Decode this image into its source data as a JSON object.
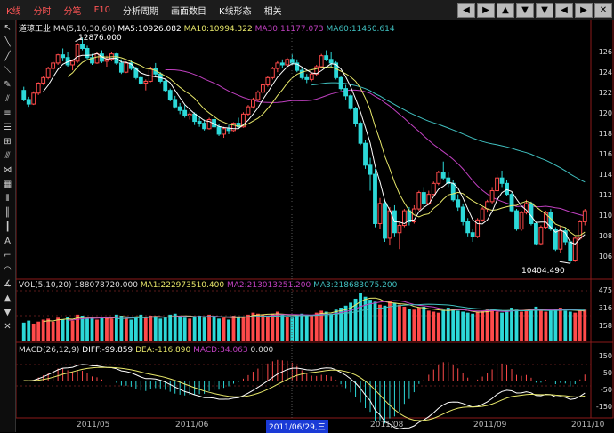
{
  "menu": [
    "K线",
    "分时",
    "分笔",
    "F10",
    "分析周期",
    "画面数目",
    "K线形态",
    "相关"
  ],
  "nav_buttons": [
    "◀",
    "▶",
    "▲",
    "▼",
    "▼",
    "◀",
    "▶",
    "✕"
  ],
  "stock_name": "道琼工业",
  "price_indicator": {
    "name": "MA(5,10,30,60)",
    "ma5": "MA5:10926.082",
    "ma10": "MA10:10994.322",
    "ma30": "MA30:11177.073",
    "ma60": "MA60:11450.614"
  },
  "high_label": "12876.000",
  "low_label": "10404.490",
  "vol_indicator": {
    "name": "VOL(5,10,20)",
    "value": "188078720.000",
    "ma1": "MA1:222973510.400",
    "ma2": "MA2:213013251.200",
    "ma3": "MA3:218683075.200"
  },
  "macd_indicator": {
    "name": "MACD(26,12,9)",
    "diff": "DIFF:-99.859",
    "dea": "DEA:-116.890",
    "macd": "MACD:34.063",
    "zero": "0.000"
  },
  "x_dates": [
    "2011/05",
    "2011/06",
    "2011/08",
    "2011/09",
    "2011/10"
  ],
  "date_cursor": "2011/06/29,三",
  "y_price_ticks": [
    "126",
    "124",
    "122",
    "120",
    "118",
    "116",
    "114",
    "112",
    "110",
    "108",
    "106"
  ],
  "y_vol_ticks": [
    "475",
    "316",
    "158"
  ],
  "y_macd_ticks": [
    "150",
    "50",
    "-50",
    "-150"
  ],
  "colors": {
    "up": "#ff4a4a",
    "down": "#2cd8d8",
    "ma5": "#ffffff",
    "ma10": "#e8e86a",
    "ma30": "#c040c0",
    "ma60": "#40c0c0"
  },
  "chart_data": {
    "type": "candlestick",
    "series_note": "Dow Jones Industrial daily OHLC, approx. May–Oct 2011",
    "ylim": [
      10250,
      12950
    ],
    "candles": [
      [
        12300,
        12340,
        12180,
        12200
      ],
      [
        12200,
        12230,
        12120,
        12150
      ],
      [
        12150,
        12290,
        12140,
        12270
      ],
      [
        12270,
        12390,
        12250,
        12380
      ],
      [
        12380,
        12460,
        12360,
        12440
      ],
      [
        12440,
        12560,
        12420,
        12540
      ],
      [
        12540,
        12620,
        12500,
        12600
      ],
      [
        12600,
        12700,
        12580,
        12690
      ],
      [
        12690,
        12760,
        12620,
        12660
      ],
      [
        12660,
        12720,
        12560,
        12580
      ],
      [
        12580,
        12640,
        12520,
        12620
      ],
      [
        12620,
        12820,
        12600,
        12800
      ],
      [
        12800,
        12876,
        12740,
        12760
      ],
      [
        12760,
        12790,
        12640,
        12660
      ],
      [
        12660,
        12700,
        12580,
        12600
      ],
      [
        12600,
        12720,
        12590,
        12700
      ],
      [
        12700,
        12740,
        12600,
        12620
      ],
      [
        12620,
        12680,
        12560,
        12640
      ],
      [
        12640,
        12720,
        12620,
        12700
      ],
      [
        12700,
        12710,
        12580,
        12600
      ],
      [
        12600,
        12640,
        12480,
        12500
      ],
      [
        12500,
        12620,
        12490,
        12600
      ],
      [
        12600,
        12630,
        12520,
        12540
      ],
      [
        12540,
        12560,
        12420,
        12440
      ],
      [
        12440,
        12460,
        12360,
        12380
      ],
      [
        12380,
        12420,
        12300,
        12400
      ],
      [
        12400,
        12560,
        12390,
        12540
      ],
      [
        12540,
        12600,
        12460,
        12480
      ],
      [
        12480,
        12500,
        12380,
        12400
      ],
      [
        12400,
        12420,
        12280,
        12300
      ],
      [
        12300,
        12320,
        12180,
        12200
      ],
      [
        12200,
        12240,
        12100,
        12120
      ],
      [
        12120,
        12160,
        12040,
        12080
      ],
      [
        12080,
        12140,
        12000,
        12020
      ],
      [
        12020,
        12060,
        11980,
        12040
      ],
      [
        12040,
        12060,
        11920,
        11960
      ],
      [
        11960,
        12000,
        11900,
        11940
      ],
      [
        11940,
        11980,
        11860,
        11880
      ],
      [
        11880,
        12000,
        11870,
        11980
      ],
      [
        11980,
        12020,
        11880,
        11900
      ],
      [
        11900,
        11930,
        11800,
        11820
      ],
      [
        11820,
        11900,
        11780,
        11880
      ],
      [
        11880,
        11920,
        11820,
        11860
      ],
      [
        11860,
        11950,
        11850,
        11940
      ],
      [
        11940,
        12000,
        11880,
        11900
      ],
      [
        11900,
        12060,
        11890,
        12040
      ],
      [
        12040,
        12140,
        12020,
        12120
      ],
      [
        12120,
        12220,
        12100,
        12200
      ],
      [
        12200,
        12300,
        12180,
        12280
      ],
      [
        12280,
        12380,
        12260,
        12360
      ],
      [
        12360,
        12460,
        12340,
        12440
      ],
      [
        12440,
        12560,
        12420,
        12540
      ],
      [
        12540,
        12620,
        12500,
        12600
      ],
      [
        12600,
        12640,
        12540,
        12580
      ],
      [
        12580,
        12660,
        12560,
        12640
      ],
      [
        12640,
        12700,
        12580,
        12600
      ],
      [
        12600,
        12640,
        12500,
        12520
      ],
      [
        12520,
        12560,
        12420,
        12440
      ],
      [
        12440,
        12480,
        12380,
        12420
      ],
      [
        12420,
        12500,
        12400,
        12480
      ],
      [
        12480,
        12580,
        12460,
        12560
      ],
      [
        12560,
        12700,
        12540,
        12680
      ],
      [
        12680,
        12740,
        12620,
        12640
      ],
      [
        12640,
        12720,
        12560,
        12600
      ],
      [
        12600,
        12620,
        12420,
        12440
      ],
      [
        12440,
        12460,
        12300,
        12320
      ],
      [
        12320,
        12360,
        12200,
        12240
      ],
      [
        12240,
        12260,
        12080,
        12100
      ],
      [
        12100,
        12120,
        11900,
        11940
      ],
      [
        11940,
        11960,
        11700,
        11720
      ],
      [
        11720,
        11760,
        11440,
        11480
      ],
      [
        11480,
        11560,
        11200,
        11380
      ],
      [
        11380,
        11440,
        10800,
        10840
      ],
      [
        10840,
        11120,
        10780,
        11060
      ],
      [
        11060,
        11100,
        10640,
        10680
      ],
      [
        10680,
        11020,
        10600,
        10980
      ],
      [
        10980,
        11040,
        10700,
        10740
      ],
      [
        10740,
        10860,
        10560,
        10820
      ],
      [
        10820,
        11000,
        10800,
        10980
      ],
      [
        10980,
        11020,
        10820,
        10860
      ],
      [
        10860,
        11040,
        10840,
        11000
      ],
      [
        11000,
        11200,
        10980,
        11180
      ],
      [
        11180,
        11240,
        11020,
        11060
      ],
      [
        11060,
        11200,
        11040,
        11160
      ],
      [
        11160,
        11300,
        11140,
        11280
      ],
      [
        11280,
        11420,
        11260,
        11400
      ],
      [
        11400,
        11520,
        11320,
        11340
      ],
      [
        11340,
        11400,
        11240,
        11280
      ],
      [
        11280,
        11320,
        11080,
        11100
      ],
      [
        11100,
        11160,
        10980,
        11020
      ],
      [
        11020,
        11060,
        10820,
        10860
      ],
      [
        10860,
        10900,
        10700,
        10740
      ],
      [
        10740,
        10780,
        10640,
        10700
      ],
      [
        10700,
        10900,
        10680,
        10880
      ],
      [
        10880,
        11020,
        10860,
        11000
      ],
      [
        11000,
        11100,
        10960,
        11080
      ],
      [
        11080,
        11240,
        11060,
        11200
      ],
      [
        11200,
        11380,
        11180,
        11340
      ],
      [
        11340,
        11420,
        11240,
        11280
      ],
      [
        11280,
        11320,
        11140,
        11160
      ],
      [
        11160,
        11180,
        10960,
        10980
      ],
      [
        10980,
        11000,
        10760,
        10780
      ],
      [
        10780,
        10980,
        10760,
        10960
      ],
      [
        10960,
        11100,
        10940,
        11060
      ],
      [
        11060,
        11080,
        10820,
        10840
      ],
      [
        10840,
        10860,
        10600,
        10620
      ],
      [
        10620,
        10820,
        10600,
        10800
      ],
      [
        10800,
        10980,
        10780,
        10960
      ],
      [
        10960,
        11000,
        10760,
        10780
      ],
      [
        10780,
        10800,
        10540,
        10560
      ],
      [
        10560,
        10820,
        10520,
        10760
      ],
      [
        10760,
        10800,
        10600,
        10640
      ],
      [
        10640,
        10660,
        10404,
        10440
      ],
      [
        10440,
        10700,
        10420,
        10680
      ],
      [
        10680,
        10880,
        10660,
        10860
      ],
      [
        10860,
        11000,
        10820,
        10980
      ]
    ],
    "volume": [
      180,
      200,
      170,
      190,
      210,
      220,
      190,
      230,
      210,
      240,
      200,
      260,
      250,
      220,
      230,
      210,
      240,
      230,
      220,
      260,
      250,
      230,
      210,
      240,
      260,
      230,
      250,
      240,
      220,
      230,
      260,
      270,
      250,
      230,
      220,
      240,
      250,
      230,
      260,
      240,
      220,
      230,
      210,
      250,
      240,
      230,
      260,
      280,
      270,
      260,
      250,
      270,
      290,
      260,
      240,
      230,
      250,
      270,
      260,
      250,
      280,
      300,
      290,
      270,
      310,
      330,
      350,
      380,
      420,
      475,
      440,
      410,
      390,
      360,
      350,
      400,
      380,
      360,
      340,
      320,
      310,
      330,
      340,
      300,
      290,
      280,
      310,
      330,
      320,
      300,
      290,
      280,
      270,
      290,
      300,
      310,
      320,
      290,
      280,
      300,
      330,
      310,
      290,
      300,
      320,
      340,
      310,
      290,
      300,
      320,
      330,
      300,
      290,
      280,
      300,
      310
    ]
  }
}
